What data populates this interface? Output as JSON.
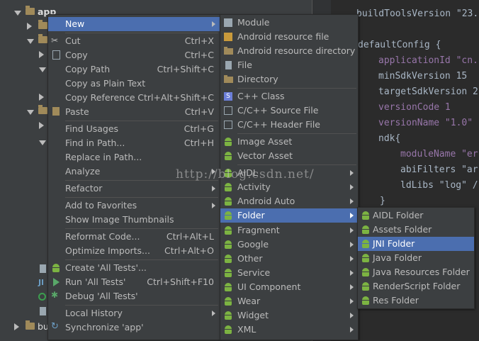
{
  "tree": {
    "root_label": "app",
    "bottom_label": "bu"
  },
  "editor": {
    "lines": [
      {
        "text": "buildToolsVersion \"23.",
        "kind": "def"
      },
      {
        "text": "defaultConfig {",
        "kind": "def"
      },
      {
        "text": "applicationId \"cn.",
        "kind": "mix"
      },
      {
        "text": "minSdkVersion 15",
        "kind": "def"
      },
      {
        "text": "targetSdkVersion 2",
        "kind": "def"
      },
      {
        "text": "versionCode 1",
        "kind": "def"
      },
      {
        "text": "versionName \"1.0\"",
        "kind": "def"
      },
      {
        "text": "ndk{",
        "kind": "def"
      },
      {
        "text": "moduleName \"er",
        "kind": "def"
      },
      {
        "text": "abiFilters \"ar",
        "kind": "def"
      },
      {
        "text": "ldLibs \"log\" /",
        "kind": "def"
      },
      {
        "text": "}",
        "kind": "def"
      }
    ]
  },
  "context_menu": {
    "items": [
      {
        "label": "New",
        "shortcut": "",
        "submenu": true,
        "icon": ""
      },
      {
        "label": "Cut",
        "shortcut": "Ctrl+X",
        "submenu": false,
        "icon": "scissors-icon"
      },
      {
        "label": "Copy",
        "shortcut": "Ctrl+C",
        "submenu": false,
        "icon": "copy-icon"
      },
      {
        "label": "Copy Path",
        "shortcut": "Ctrl+Shift+C",
        "submenu": false,
        "icon": ""
      },
      {
        "label": "Copy as Plain Text",
        "shortcut": "",
        "submenu": false,
        "icon": ""
      },
      {
        "label": "Copy Reference",
        "shortcut": "Ctrl+Alt+Shift+C",
        "submenu": false,
        "icon": ""
      },
      {
        "label": "Paste",
        "shortcut": "Ctrl+V",
        "submenu": false,
        "icon": "paste-icon"
      },
      {
        "label": "Find Usages",
        "shortcut": "Ctrl+G",
        "submenu": false,
        "icon": ""
      },
      {
        "label": "Find in Path...",
        "shortcut": "Ctrl+H",
        "submenu": false,
        "icon": ""
      },
      {
        "label": "Replace in Path...",
        "shortcut": "",
        "submenu": false,
        "icon": ""
      },
      {
        "label": "Analyze",
        "shortcut": "",
        "submenu": true,
        "icon": ""
      },
      {
        "label": "Refactor",
        "shortcut": "",
        "submenu": true,
        "icon": ""
      },
      {
        "label": "Add to Favorites",
        "shortcut": "",
        "submenu": true,
        "icon": ""
      },
      {
        "label": "Show Image Thumbnails",
        "shortcut": "",
        "submenu": false,
        "icon": ""
      },
      {
        "label": "Reformat Code...",
        "shortcut": "Ctrl+Alt+L",
        "submenu": false,
        "icon": ""
      },
      {
        "label": "Optimize Imports...",
        "shortcut": "Ctrl+Alt+O",
        "submenu": false,
        "icon": ""
      },
      {
        "label": "Create 'All Tests'...",
        "shortcut": "",
        "submenu": false,
        "icon": "android-test-icon"
      },
      {
        "label": "Run 'All Tests'",
        "shortcut": "Ctrl+Shift+F10",
        "submenu": false,
        "icon": "run-icon"
      },
      {
        "label": "Debug 'All Tests'",
        "shortcut": "",
        "submenu": false,
        "icon": "debug-icon"
      },
      {
        "label": "Local History",
        "shortcut": "",
        "submenu": true,
        "icon": ""
      },
      {
        "label": "Synchronize 'app'",
        "shortcut": "",
        "submenu": false,
        "icon": "sync-icon"
      }
    ]
  },
  "new_menu": {
    "items": [
      {
        "label": "Module",
        "submenu": false,
        "icon": "module-icon"
      },
      {
        "label": "Android resource file",
        "submenu": false,
        "icon": "resource-file-icon"
      },
      {
        "label": "Android resource directory",
        "submenu": false,
        "icon": "folder-icon"
      },
      {
        "label": "File",
        "submenu": false,
        "icon": "file-icon"
      },
      {
        "label": "Directory",
        "submenu": false,
        "icon": "folder-icon"
      },
      {
        "label": "C++ Class",
        "submenu": false,
        "icon": "cpp-class-icon"
      },
      {
        "label": "C/C++ Source File",
        "submenu": false,
        "icon": "cpp-source-icon"
      },
      {
        "label": "C/C++ Header File",
        "submenu": false,
        "icon": "cpp-header-icon"
      },
      {
        "label": "Image Asset",
        "submenu": false,
        "icon": "android-icon"
      },
      {
        "label": "Vector Asset",
        "submenu": false,
        "icon": "android-icon"
      },
      {
        "label": "AIDL",
        "submenu": true,
        "icon": "android-icon"
      },
      {
        "label": "Activity",
        "submenu": true,
        "icon": "android-icon"
      },
      {
        "label": "Android Auto",
        "submenu": true,
        "icon": "android-icon"
      },
      {
        "label": "Folder",
        "submenu": true,
        "icon": "android-icon"
      },
      {
        "label": "Fragment",
        "submenu": true,
        "icon": "android-icon"
      },
      {
        "label": "Google",
        "submenu": true,
        "icon": "android-icon"
      },
      {
        "label": "Other",
        "submenu": true,
        "icon": "android-icon"
      },
      {
        "label": "Service",
        "submenu": true,
        "icon": "android-icon"
      },
      {
        "label": "UI Component",
        "submenu": true,
        "icon": "android-icon"
      },
      {
        "label": "Wear",
        "submenu": true,
        "icon": "android-icon"
      },
      {
        "label": "Widget",
        "submenu": true,
        "icon": "android-icon"
      },
      {
        "label": "XML",
        "submenu": true,
        "icon": "android-icon"
      }
    ]
  },
  "folder_menu": {
    "items": [
      {
        "label": "AIDL Folder"
      },
      {
        "label": "Assets Folder"
      },
      {
        "label": "JNI Folder"
      },
      {
        "label": "Java Folder"
      },
      {
        "label": "Java Resources Folder"
      },
      {
        "label": "RenderScript Folder"
      },
      {
        "label": "Res Folder"
      }
    ]
  },
  "watermark": "http://blog.csdn.net/",
  "colors": {
    "highlight": "#4b6eaf",
    "menu_bg": "#3c3f41",
    "android_green": "#7cb342"
  }
}
